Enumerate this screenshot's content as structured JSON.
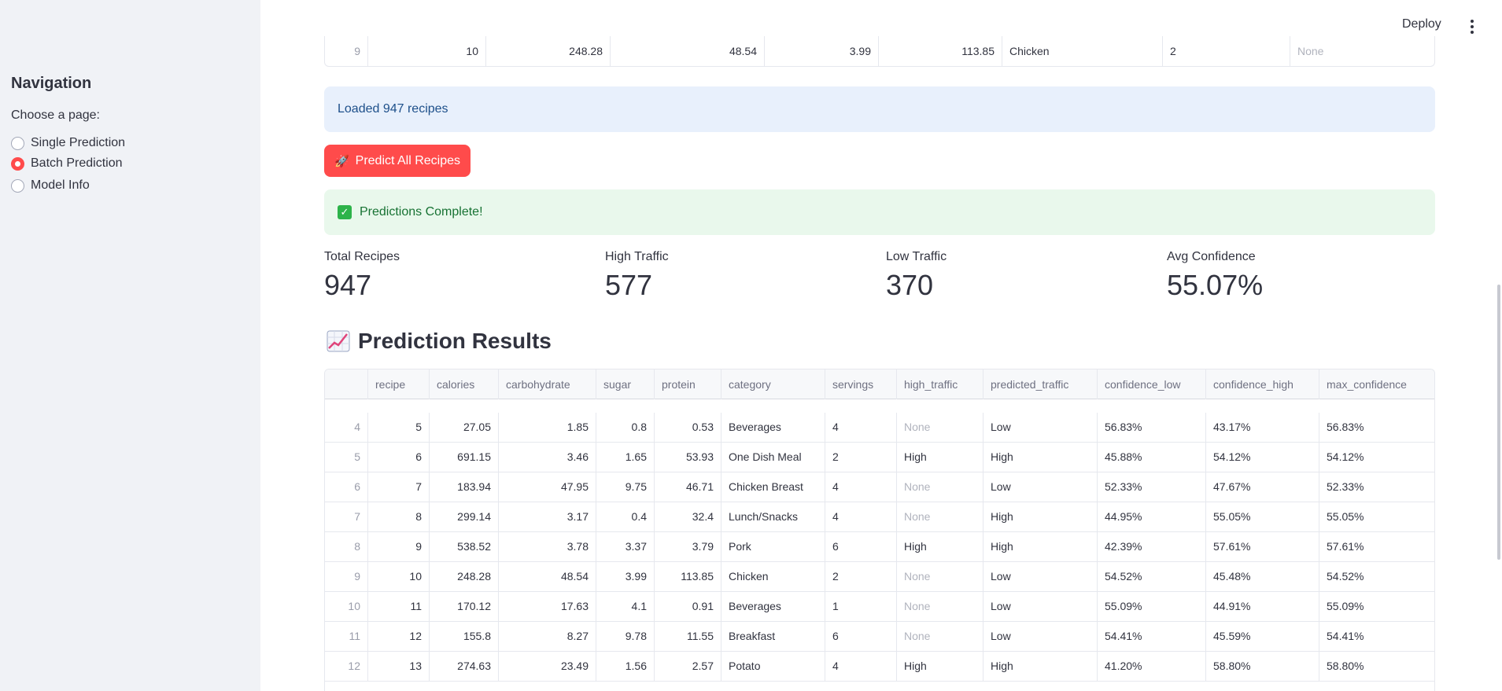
{
  "sidebar": {
    "title": "Navigation",
    "choose_label": "Choose a page:",
    "options": [
      {
        "label": "Single Prediction",
        "checked": false
      },
      {
        "label": "Batch Prediction",
        "checked": true
      },
      {
        "label": "Model Info",
        "checked": false
      }
    ]
  },
  "topbar": {
    "deploy": "Deploy",
    "menu_icon": "kebab-menu-icon"
  },
  "top_table_row": [
    "9",
    "10",
    "248.28",
    "48.54",
    "3.99",
    "113.85",
    "Chicken",
    "2",
    "None"
  ],
  "info": {
    "text": "Loaded 947 recipes"
  },
  "predict_button": {
    "label": "Predict All Recipes",
    "icon": "rocket-icon"
  },
  "success": {
    "text": "Predictions Complete!",
    "icon": "check-icon"
  },
  "metrics": [
    {
      "label": "Total Recipes",
      "value": "947"
    },
    {
      "label": "High Traffic",
      "value": "577"
    },
    {
      "label": "Low Traffic",
      "value": "370"
    },
    {
      "label": "Avg Confidence",
      "value": "55.07%"
    }
  ],
  "results": {
    "title": "Prediction Results",
    "icon": "chart-increasing-icon",
    "columns": [
      "",
      "recipe",
      "calories",
      "carbohydrate",
      "sugar",
      "protein",
      "category",
      "servings",
      "high_traffic",
      "predicted_traffic",
      "confidence_low",
      "confidence_high",
      "max_confidence"
    ],
    "rows": [
      [
        "4",
        "5",
        "27.05",
        "1.85",
        "0.8",
        "0.53",
        "Beverages",
        "4",
        "None",
        "Low",
        "56.83%",
        "43.17%",
        "56.83%"
      ],
      [
        "5",
        "6",
        "691.15",
        "3.46",
        "1.65",
        "53.93",
        "One Dish Meal",
        "2",
        "High",
        "High",
        "45.88%",
        "54.12%",
        "54.12%"
      ],
      [
        "6",
        "7",
        "183.94",
        "47.95",
        "9.75",
        "46.71",
        "Chicken Breast",
        "4",
        "None",
        "Low",
        "52.33%",
        "47.67%",
        "52.33%"
      ],
      [
        "7",
        "8",
        "299.14",
        "3.17",
        "0.4",
        "32.4",
        "Lunch/Snacks",
        "4",
        "None",
        "High",
        "44.95%",
        "55.05%",
        "55.05%"
      ],
      [
        "8",
        "9",
        "538.52",
        "3.78",
        "3.37",
        "3.79",
        "Pork",
        "6",
        "High",
        "High",
        "42.39%",
        "57.61%",
        "57.61%"
      ],
      [
        "9",
        "10",
        "248.28",
        "48.54",
        "3.99",
        "113.85",
        "Chicken",
        "2",
        "None",
        "Low",
        "54.52%",
        "45.48%",
        "54.52%"
      ],
      [
        "10",
        "11",
        "170.12",
        "17.63",
        "4.1",
        "0.91",
        "Beverages",
        "1",
        "None",
        "Low",
        "55.09%",
        "44.91%",
        "55.09%"
      ],
      [
        "11",
        "12",
        "155.8",
        "8.27",
        "9.78",
        "11.55",
        "Breakfast",
        "6",
        "None",
        "Low",
        "54.41%",
        "45.59%",
        "54.41%"
      ],
      [
        "12",
        "13",
        "274.63",
        "23.49",
        "1.56",
        "2.57",
        "Potato",
        "4",
        "High",
        "High",
        "41.20%",
        "58.80%",
        "58.80%"
      ]
    ]
  }
}
